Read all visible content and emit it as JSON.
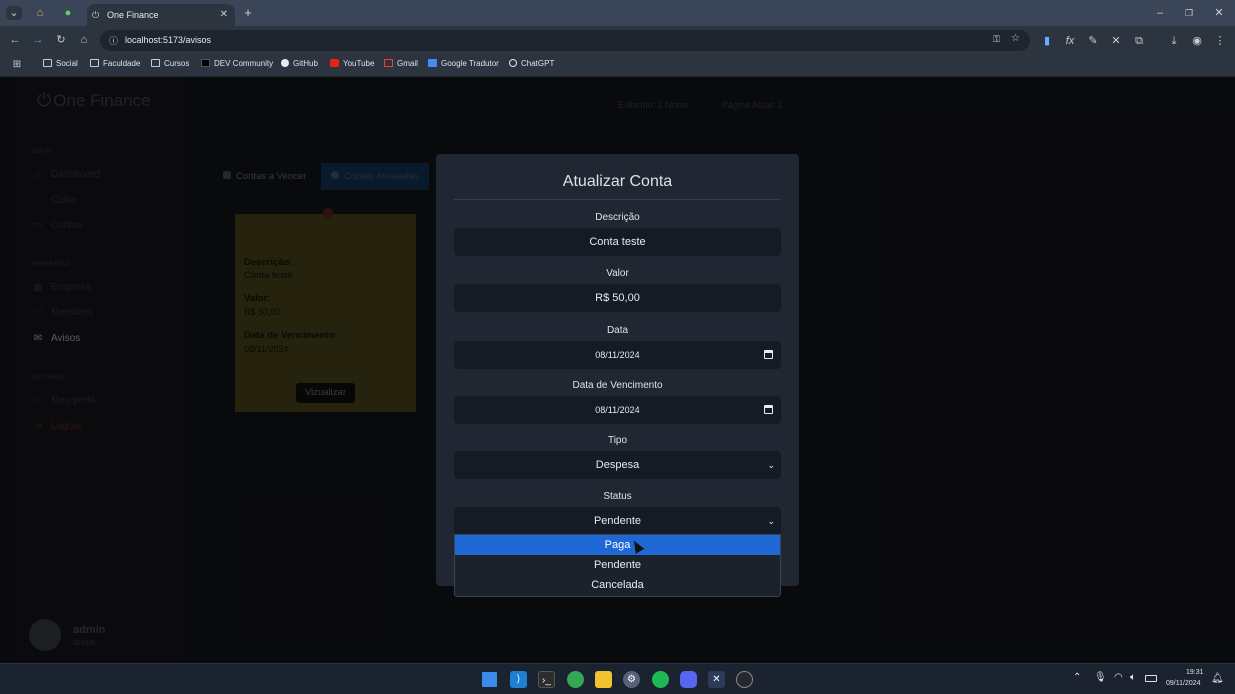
{
  "browser": {
    "tab_title": "One Finance",
    "url": "localhost:5173/avisos",
    "bookmarks": [
      "Social",
      "Faculdade",
      "Cursos",
      "DEV Community",
      "GitHub",
      "YouTube",
      "Gmail",
      "Google Tradutor",
      "ChatGPT"
    ]
  },
  "app": {
    "brand": "One Finance",
    "header_info": [
      "Exibindo: 1 Notas",
      "Página Atual: 1"
    ],
    "sidebar": {
      "sections": [
        {
          "title": "MAIN",
          "items": [
            "Dashboard",
            "Caixa",
            "Contas"
          ]
        },
        {
          "title": "EMPRESA",
          "items": [
            "Empresa",
            "Membros",
            "Avisos"
          ]
        },
        {
          "title": "OUTROS",
          "items": [
            "Meu perfil",
            "Logout"
          ]
        }
      ]
    },
    "tabs": [
      "Contas a Vencer",
      "Contas Atrasadas"
    ],
    "note": {
      "descricao_label": "Descrição:",
      "descricao": "Conta teste",
      "valor_label": "Valor:",
      "valor": "R$ 50,00",
      "venc_label": "Data de Vencimento:",
      "venc": "08/11/2024",
      "button": "Vizualizar"
    },
    "user": {
      "name": "admin",
      "role": "ADMIN"
    }
  },
  "modal": {
    "title": "Atualizar Conta",
    "fields": [
      {
        "label": "Descrição",
        "value": "Conta teste"
      },
      {
        "label": "Valor",
        "value": "R$ 50,00"
      },
      {
        "label": "Data",
        "value": "08/11/2024"
      },
      {
        "label": "Data de Vencimento",
        "value": "08/11/2024"
      },
      {
        "label": "Tipo",
        "value": "Despesa"
      },
      {
        "label": "Status",
        "value": "Pendente"
      }
    ],
    "status_options": [
      "Paga",
      "Pendente",
      "Cancelada"
    ],
    "highlighted_option": "Paga"
  },
  "taskbar": {
    "time": "19:31",
    "date": "09/11/2024"
  },
  "colors": {
    "accent": "#1e68d6",
    "modal_bg": "#202733",
    "field_bg": "#151b25",
    "note": "#e8d44d"
  }
}
